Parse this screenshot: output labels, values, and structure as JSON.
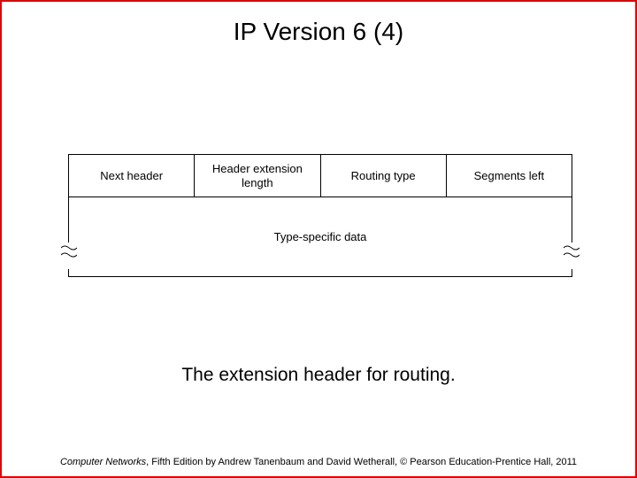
{
  "title": "IP Version 6 (4)",
  "header_fields": {
    "f1": "Next header",
    "f2": "Header extension length",
    "f3": "Routing type",
    "f4": "Segments left"
  },
  "body_field": "Type-specific data",
  "caption": "The extension header for routing.",
  "footer": {
    "book": "Computer Networks",
    "rest": ", Fifth Edition by Andrew Tanenbaum and David Wetherall, © Pearson Education-Prentice Hall, 2011"
  }
}
